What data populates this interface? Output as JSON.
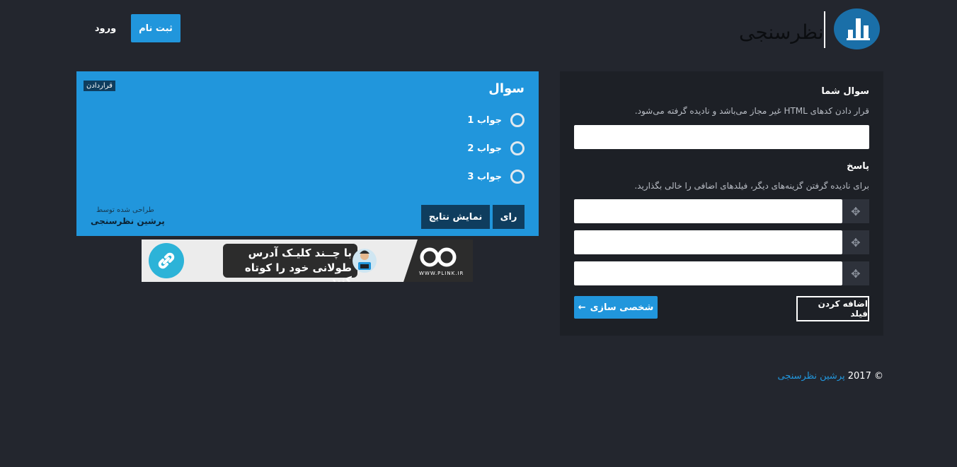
{
  "header": {
    "logo_text": "نظرسنجی",
    "register_label": "ثبت نام",
    "login_label": "ورود"
  },
  "form": {
    "question_label": "سوال شما",
    "question_help": "قرار دادن کدهای HTML غیر مجاز می‌باشد و نادیده گرفته می‌شود.",
    "question_value": "",
    "answers_label": "پاسخ",
    "answers_help": "برای نادیده گرفتن گزینه‌های دیگر، فیلدهای اضافی را خالی بگذارید.",
    "answer_fields": [
      "",
      "",
      ""
    ],
    "add_field_label": "اضافه کردن فیلد",
    "customize_label": "شخصی سازی",
    "customize_arrow": "←"
  },
  "preview": {
    "title": "سوال",
    "embed_label": "قراردادن",
    "answers": [
      "جواب 1",
      "جواب 2",
      "جواب 3"
    ],
    "vote_label": "رای",
    "results_label": "نمایش نتایج",
    "credit_small": "طراحی شده توسط",
    "credit_name": "پرشین نظرسنجی"
  },
  "banner": {
    "line1": "با چــند کلیـک آدرس",
    "line2": "طولانی خود را کوتاه کنید",
    "url": "WWW.PLINK.IR",
    "icons": [
      "link-icon",
      "plink-logo-icon"
    ]
  },
  "footer": {
    "copyright": "© 2017",
    "link_text": "پرشین نظرسنجی"
  },
  "colors": {
    "background": "#23262e",
    "panel": "#1d2026",
    "accent": "#2196dc",
    "dark_button": "#0f3d5e"
  }
}
